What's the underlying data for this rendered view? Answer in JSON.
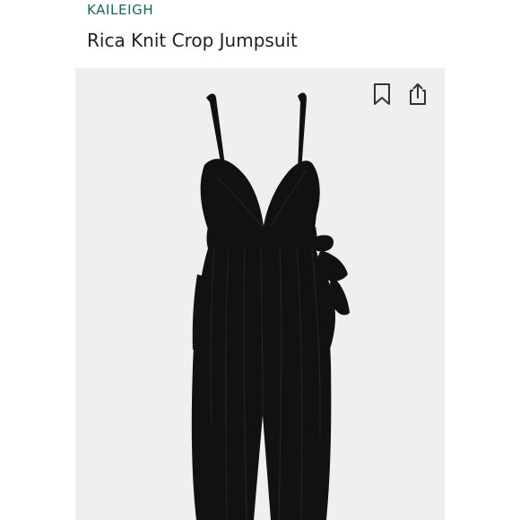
{
  "product": {
    "brand": "KAILEIGH",
    "title": "Rica Knit Crop Jumpsuit"
  },
  "icons": {
    "bookmark": "bookmark-icon",
    "share": "share-icon"
  },
  "colors": {
    "brand_text": "#0f6b57",
    "title_text": "#1f1f1f",
    "image_background": "#efefef",
    "garment": "#111111"
  }
}
